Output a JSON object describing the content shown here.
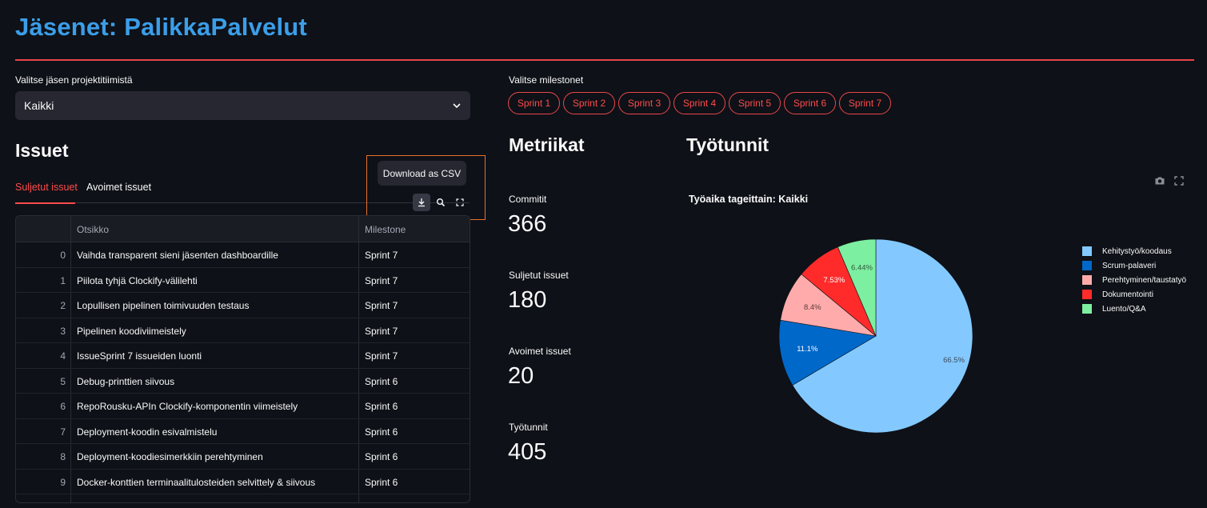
{
  "page": {
    "title": "Jäsenet: PalikkaPalvelut"
  },
  "member_select": {
    "label": "Valitse jäsen projektitiimistä",
    "value": "Kaikki"
  },
  "milestones": {
    "label": "Valitse milestonet",
    "chips": [
      "Sprint 1",
      "Sprint 2",
      "Sprint 3",
      "Sprint 4",
      "Sprint 5",
      "Sprint 6",
      "Sprint 7"
    ]
  },
  "issues": {
    "heading": "Issuet",
    "tabs": [
      "Suljetut issuet",
      "Avoimet issuet"
    ],
    "active_tab": "Suljetut issuet",
    "tooltip": "Download as CSV",
    "columns": [
      "Otsikko",
      "Milestone"
    ],
    "rows": [
      {
        "index": "0",
        "title": "Vaihda transparent sieni jäsenten dashboardille",
        "milestone": "Sprint 7"
      },
      {
        "index": "1",
        "title": "Piilota tyhjä Clockify-välilehti",
        "milestone": "Sprint 7"
      },
      {
        "index": "2",
        "title": "Lopullisen pipelinen toimivuuden testaus",
        "milestone": "Sprint 7"
      },
      {
        "index": "3",
        "title": "Pipelinen koodiviimeistely",
        "milestone": "Sprint 7"
      },
      {
        "index": "4",
        "title": "IssueSprint 7 issueiden luonti",
        "milestone": "Sprint 7"
      },
      {
        "index": "5",
        "title": "Debug-printtien siivous",
        "milestone": "Sprint 6"
      },
      {
        "index": "6",
        "title": "RepoRousku-APIn Clockify-komponentin viimeistely",
        "milestone": "Sprint 6"
      },
      {
        "index": "7",
        "title": "Deployment-koodin esivalmistelu",
        "milestone": "Sprint 6"
      },
      {
        "index": "8",
        "title": "Deployment-koodiesimerkkiin perehtyminen",
        "milestone": "Sprint 6"
      },
      {
        "index": "9",
        "title": "Docker-konttien terminaalitulosteiden selvittely & siivous",
        "milestone": "Sprint 6"
      }
    ]
  },
  "metrics": {
    "heading": "Metriikat",
    "items": [
      {
        "label": "Commitit",
        "value": "366"
      },
      {
        "label": "Suljetut issuet",
        "value": "180"
      },
      {
        "label": "Avoimet issuet",
        "value": "20"
      },
      {
        "label": "Työtunnit",
        "value": "405"
      }
    ]
  },
  "hours": {
    "heading": "Työtunnit"
  },
  "chart_data": {
    "type": "pie",
    "title": "Työaika tageittain: Kaikki",
    "slices": [
      {
        "name": "Kehitystyö/koodaus",
        "value": 66.5,
        "label": "66.5%",
        "color": "#83c9ff"
      },
      {
        "name": "Scrum-palaveri",
        "value": 11.1,
        "label": "11.1%",
        "color": "#0068c9"
      },
      {
        "name": "Perehtyminen/taustatyö",
        "value": 8.4,
        "label": "8.4%",
        "color": "#ffabab"
      },
      {
        "name": "Dokumentointi",
        "value": 7.53,
        "label": "7.53%",
        "color": "#ff2b2b"
      },
      {
        "name": "Luento/Q&A",
        "value": 6.44,
        "label": "6.44%",
        "color": "#7defa1"
      }
    ],
    "legend_position": "right"
  }
}
